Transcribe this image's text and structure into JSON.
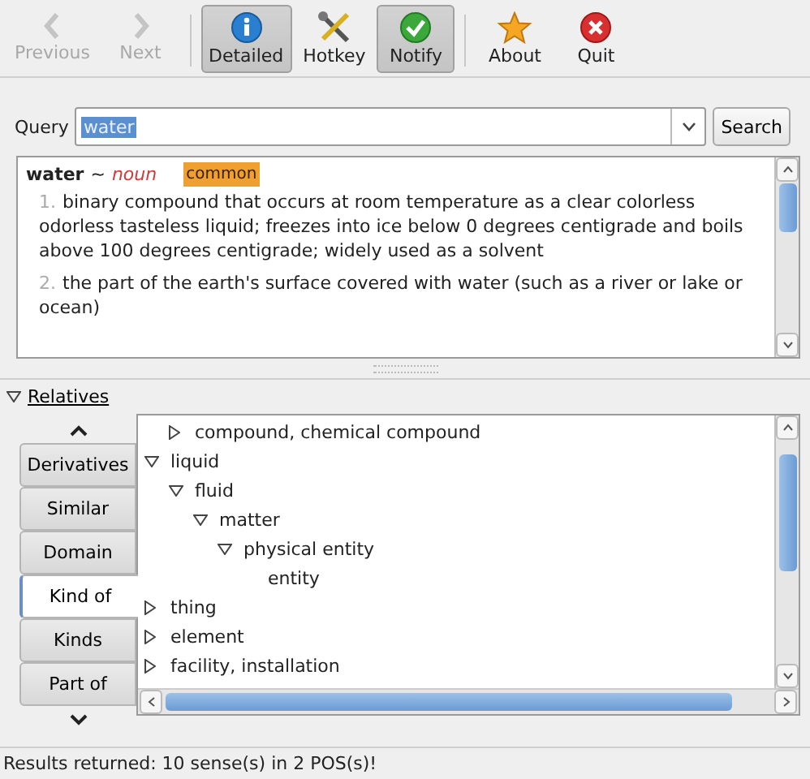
{
  "toolbar": [
    {
      "label": "Previous",
      "disabled": true,
      "checked": false
    },
    {
      "label": "Next",
      "disabled": true,
      "checked": false
    },
    {
      "label": "Detailed",
      "disabled": false,
      "checked": true
    },
    {
      "label": "Hotkey",
      "disabled": false,
      "checked": false
    },
    {
      "label": "Notify",
      "disabled": false,
      "checked": true
    },
    {
      "label": "About",
      "disabled": false,
      "checked": false
    },
    {
      "label": "Quit",
      "disabled": false,
      "checked": false
    }
  ],
  "query": {
    "label": "Query",
    "value": "water",
    "button": "Search"
  },
  "definition": {
    "word": "water",
    "separator": "~",
    "pos": "noun",
    "tag": "common",
    "senses": [
      {
        "number": "1.",
        "text": "binary compound that occurs at room temperature as a clear colorless odorless tasteless liquid; freezes into ice below 0 degrees centigrade and boils above 100 degrees centigrade; widely used as a solvent"
      },
      {
        "number": "2.",
        "text": "the part of the earth's surface covered with water (such as a river or lake or ocean)"
      }
    ]
  },
  "relatives": {
    "title": "Relatives",
    "expanded": true,
    "tabs": [
      {
        "label": "Derivatives",
        "selected": false
      },
      {
        "label": "Similar",
        "selected": false
      },
      {
        "label": "Domain",
        "selected": false
      },
      {
        "label": "Kind of",
        "selected": true
      },
      {
        "label": "Kinds",
        "selected": false
      },
      {
        "label": "Part of",
        "selected": false
      }
    ],
    "tree": [
      {
        "children": [
          {
            "label": "compound, chemical compound",
            "expanded": false
          }
        ]
      },
      {
        "label": "liquid",
        "expanded": true,
        "children": [
          {
            "label": "fluid",
            "expanded": true,
            "children": [
              {
                "label": "matter",
                "expanded": true,
                "children": [
                  {
                    "label": "physical entity",
                    "expanded": true,
                    "children": [
                      {
                        "label": "entity"
                      }
                    ]
                  }
                ]
              }
            ]
          }
        ]
      },
      {
        "label": "thing",
        "expanded": false
      },
      {
        "label": "element",
        "expanded": false
      },
      {
        "label": "facility, installation",
        "expanded": false
      }
    ]
  },
  "status_bar": "Results returned: 10 sense(s) in 2 POS(s)!"
}
